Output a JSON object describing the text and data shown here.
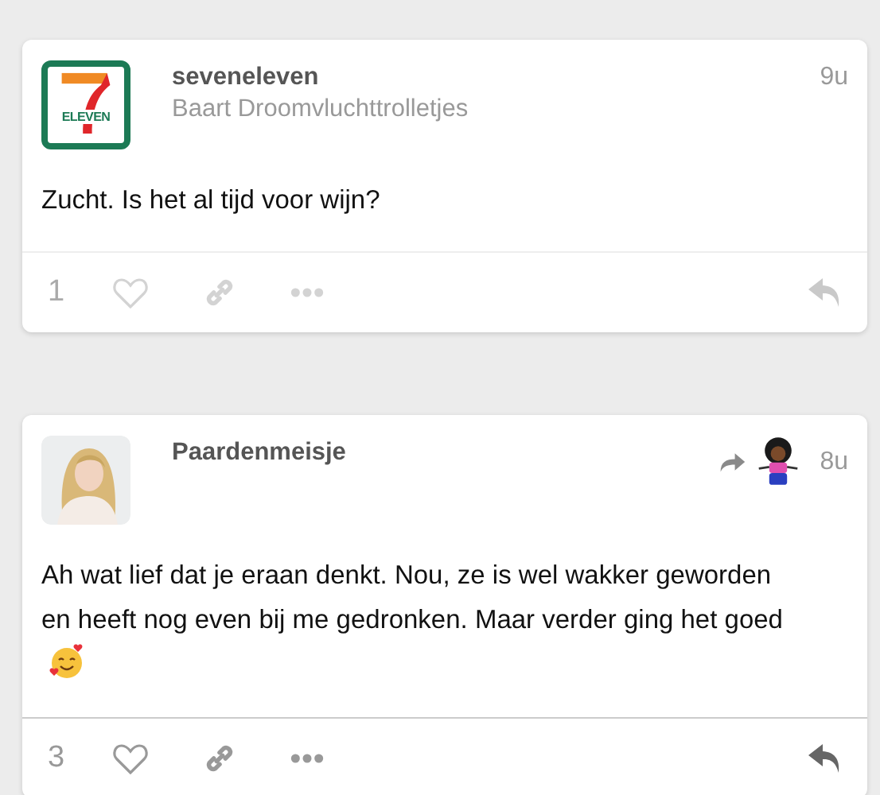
{
  "posts": [
    {
      "author": "seveneleven",
      "subtitle": "Baart Droomvluchttrolletjes",
      "time": "9u",
      "avatar": {
        "kind": "logo",
        "logo_text": "ELEVEN"
      },
      "reposted": false,
      "text": "Zucht. Is het al tijd voor wijn?",
      "emoji": false,
      "likes": "1",
      "dimmed": true
    },
    {
      "author": "Paardenmeisje",
      "time": "8u",
      "reposted": true,
      "text": "Ah wat lief dat je eraan denkt. Nou, ze is wel wakker geworden en heeft nog even bij me gedronken. Maar verder ging het goed",
      "emoji": true,
      "likes": "3",
      "dimmed": false
    }
  ]
}
